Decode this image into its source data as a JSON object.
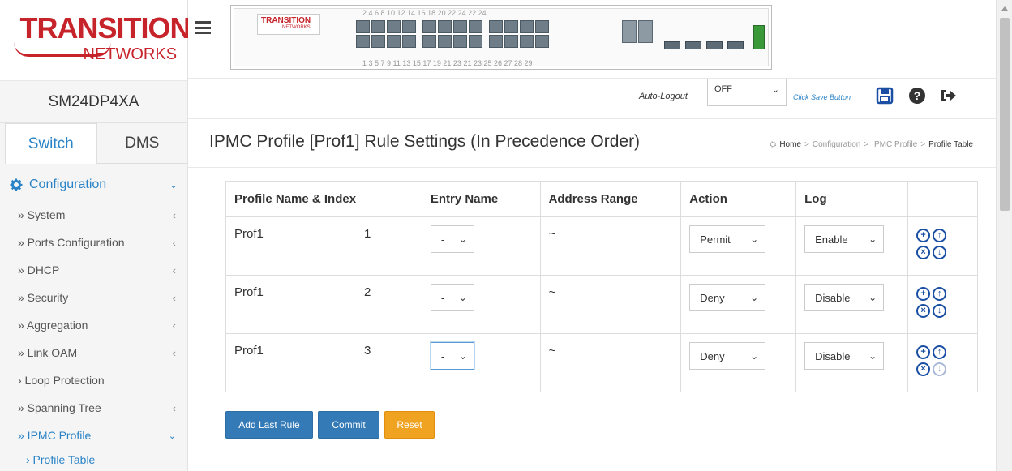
{
  "brand": {
    "logo_top": "TRANSITION",
    "logo_bottom": "NETWORKS",
    "device_name": "SM24DP4XA"
  },
  "switch_panel": {
    "logo_top": "TRANSITION",
    "logo_bottom": "NETWORKS",
    "top_numbers": "2  4  6  8  10 12 14 16  18 20 22 24    22 24",
    "bottom_numbers": "1  3  5  7  9 11 13 15  17 19 21 23    21 23    25  26  27  28     29"
  },
  "tabs": [
    {
      "label": "Switch",
      "active": true
    },
    {
      "label": "DMS",
      "active": false
    }
  ],
  "nav": {
    "section": "Configuration",
    "items": [
      {
        "label": "» System",
        "arrow": "‹"
      },
      {
        "label": "» Ports Configuration",
        "arrow": "‹"
      },
      {
        "label": "» DHCP",
        "arrow": "‹"
      },
      {
        "label": "» Security",
        "arrow": "‹"
      },
      {
        "label": "» Aggregation",
        "arrow": "‹"
      },
      {
        "label": "» Link OAM",
        "arrow": "‹"
      },
      {
        "label": "› Loop Protection",
        "arrow": ""
      },
      {
        "label": "» Spanning Tree",
        "arrow": "‹"
      },
      {
        "label": "» IPMC Profile",
        "arrow": "⌄"
      }
    ],
    "sub_item": "› Profile Table"
  },
  "toolbar": {
    "auto_logout_label": "Auto-Logout",
    "auto_logout_value": "OFF",
    "save_hint": "Click Save Button"
  },
  "page": {
    "title": "IPMC Profile [Prof1] Rule Settings (In Precedence Order)",
    "breadcrumb": [
      "Home",
      "Configuration",
      "IPMC Profile",
      "Profile Table"
    ]
  },
  "table": {
    "headers": [
      "Profile Name & Index",
      "Entry Name",
      "Address Range",
      "Action",
      "Log"
    ],
    "rows": [
      {
        "name": "Prof1",
        "index": "1",
        "entry": "-",
        "range": "~",
        "action": "Permit",
        "log": "Enable"
      },
      {
        "name": "Prof1",
        "index": "2",
        "entry": "-",
        "range": "~",
        "action": "Deny",
        "log": "Disable"
      },
      {
        "name": "Prof1",
        "index": "3",
        "entry": "-",
        "range": "~",
        "action": "Deny",
        "log": "Disable"
      }
    ]
  },
  "buttons": {
    "add_last_rule": "Add Last Rule",
    "commit": "Commit",
    "reset": "Reset"
  },
  "colors": {
    "brand_red": "#c7232b",
    "link_blue": "#2a83c6",
    "button_blue": "#337ab7",
    "button_orange": "#f0a321"
  }
}
